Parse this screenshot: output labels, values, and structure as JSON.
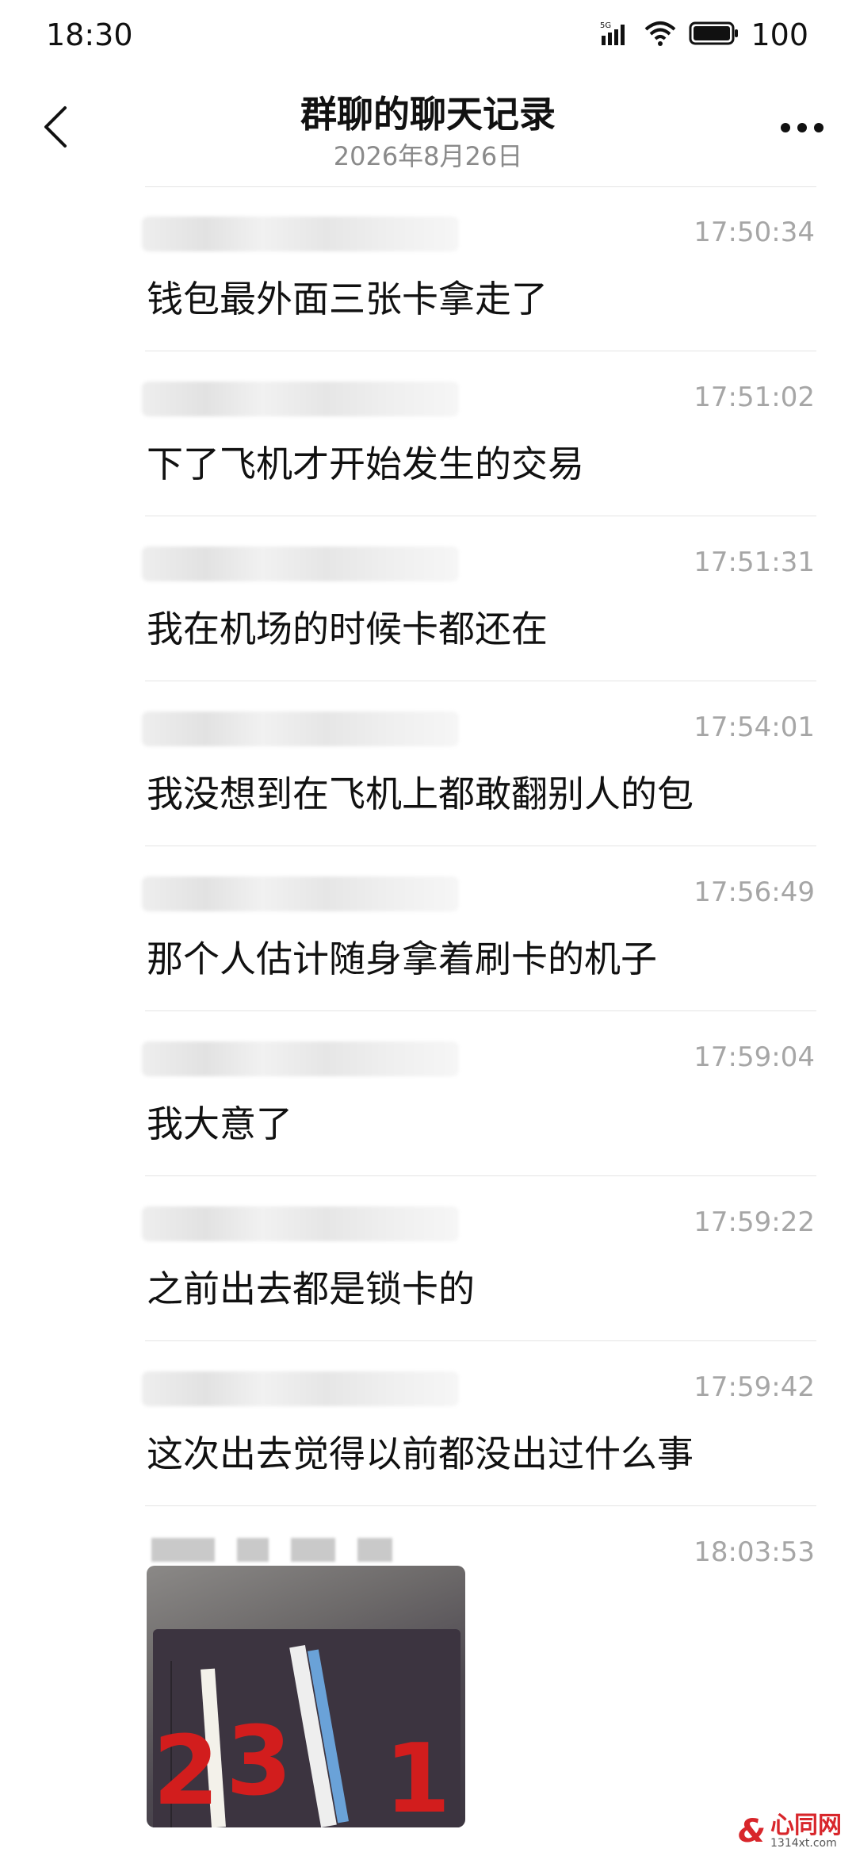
{
  "status_bar": {
    "time": "18:30",
    "battery": "100",
    "network": "5G"
  },
  "nav": {
    "title": "群聊的聊天记录",
    "subtitle": "2026年8月26日"
  },
  "messages": [
    {
      "time": "17:50:34",
      "text": "钱包最外面三张卡拿走了"
    },
    {
      "time": "17:51:02",
      "text": "下了飞机才开始发生的交易"
    },
    {
      "time": "17:51:31",
      "text": "我在机场的时候卡都还在"
    },
    {
      "time": "17:54:01",
      "text": "我没想到在飞机上都敢翻别人的包"
    },
    {
      "time": "17:56:49",
      "text": "那个人估计随身拿着刷卡的机子"
    },
    {
      "time": "17:59:04",
      "text": "我大意了"
    },
    {
      "time": "17:59:22",
      "text": "之前出去都是锁卡的"
    },
    {
      "time": "17:59:42",
      "text": "这次出去觉得以前都没出过什么事"
    }
  ],
  "image_message": {
    "time": "18:03:53",
    "photo_labels": [
      "2",
      "3",
      "1"
    ]
  },
  "watermark": {
    "logo": "&",
    "name": "心同网",
    "url": "1314xt.com"
  },
  "colors": {
    "text": "#111111",
    "secondary": "#8a8a8a",
    "time": "#a6a6a6",
    "divider": "#e4e4e4",
    "photo_number": "#d21d1d",
    "watermark": "#d8262b"
  },
  "icons": [
    "back-chevron-icon",
    "more-dots-icon",
    "signal-5g-icon",
    "wifi-icon",
    "battery-icon"
  ]
}
